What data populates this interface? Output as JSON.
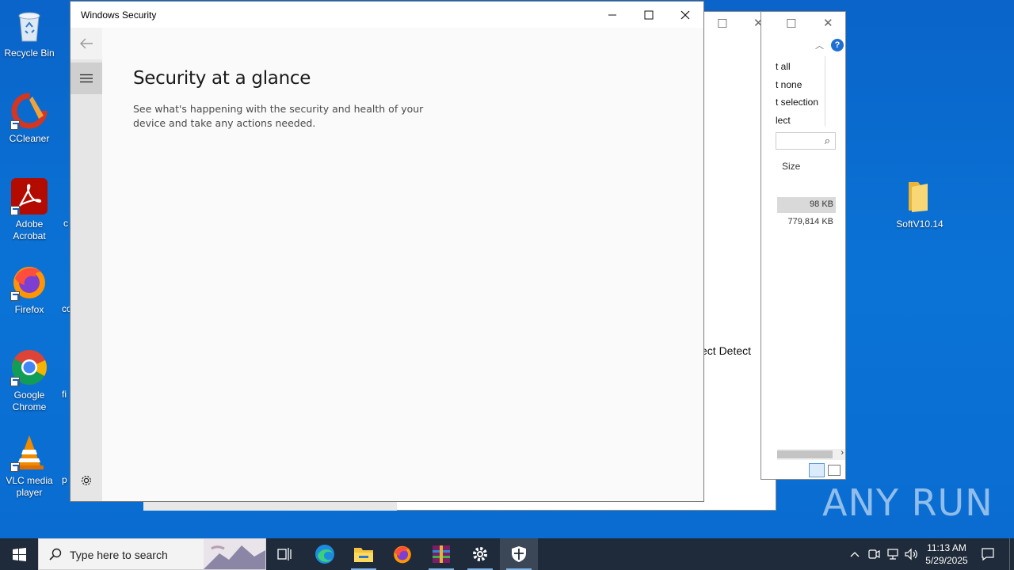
{
  "desktop": {
    "icons": [
      {
        "label": "Recycle Bin"
      },
      {
        "label": "CCleaner"
      },
      {
        "label": "Adobe Acrobat"
      },
      {
        "label": "Firefox"
      },
      {
        "label": "Google Chrome"
      },
      {
        "label": "VLC media player"
      },
      {
        "label": "SoftV10.14"
      }
    ],
    "partial_labels": [
      "c",
      "co",
      "fi",
      "p"
    ]
  },
  "background_window": {
    "text": "ect Detect",
    "menu_items": [
      "t all",
      "t none",
      "t selection",
      "lect"
    ],
    "column_size": "Size",
    "rows": [
      "98 KB",
      "779,814 KB"
    ]
  },
  "window": {
    "title": "Windows Security",
    "heading": "Security at a glance",
    "description": "See what's happening with the security and health of your device and take any actions needed."
  },
  "taskbar": {
    "search_placeholder": "Type here to search",
    "time": "11:13 AM",
    "date": "5/29/2025"
  },
  "watermark": "ANY RUN"
}
